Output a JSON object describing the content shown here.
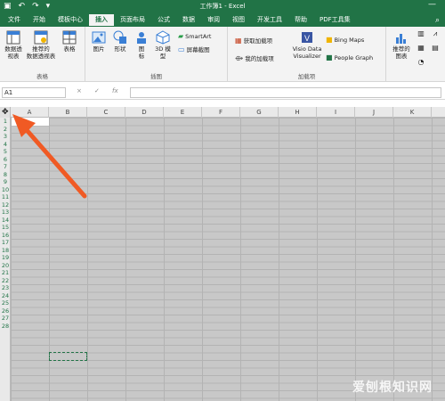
{
  "title_bar": {
    "title": "工作簿1 - Excel",
    "undo": "↶",
    "redo": "↷",
    "qat_more": "▾",
    "minimize": "—"
  },
  "tabs": [
    "文件",
    "开始",
    "模板中心",
    "插入",
    "页面布局",
    "公式",
    "数据",
    "审阅",
    "视图",
    "开发工具",
    "帮助",
    "PDF工具集"
  ],
  "active_tab": "插入",
  "ribbon": {
    "tables": {
      "pivot": "数据透\n视表",
      "recommended_pivot": "推荐的\n数据透视表",
      "table": "表格",
      "group_label": "表格"
    },
    "illustrations": {
      "pictures": "图片",
      "shapes": "形状",
      "icons": "图\n标",
      "models": "3D 模\n型",
      "smartart": "SmartArt",
      "screenshot": "屏幕截图",
      "group_label": "插图"
    },
    "addins": {
      "get": "获取加载项",
      "my": "我的加载项",
      "visio": "Visio Data\nVisualizer",
      "bing": "Bing Maps",
      "people": "People Graph",
      "group_label": "加载项"
    },
    "charts": {
      "recommended": "推荐的\n图表"
    }
  },
  "formula_bar": {
    "name_box": "A1",
    "cancel": "×",
    "enter": "✓",
    "fx": "fx",
    "value": ""
  },
  "columns": [
    "A",
    "B",
    "C",
    "D",
    "E",
    "F",
    "G",
    "H",
    "I",
    "J",
    "K"
  ],
  "rows": [
    "1",
    "2",
    "3",
    "4",
    "5",
    "6",
    "7",
    "8",
    "9",
    "10",
    "11",
    "12",
    "13",
    "14",
    "15",
    "16",
    "17",
    "18",
    "19",
    "20",
    "21",
    "22",
    "23",
    "24",
    "25",
    "26",
    "27",
    "28"
  ],
  "watermark": "爱刨根知识网",
  "colors": {
    "excel_green": "#217346",
    "arrow": "#f05a24",
    "grid_bg": "#c8c8c8"
  }
}
